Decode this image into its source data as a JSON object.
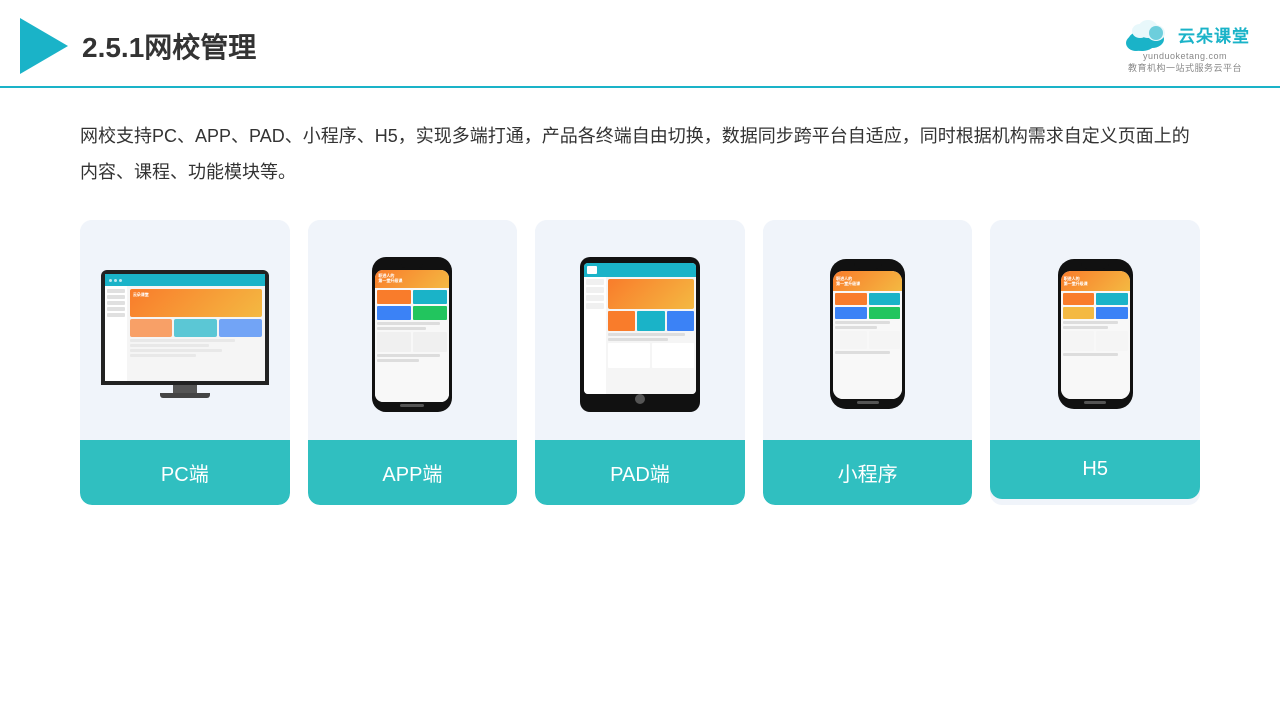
{
  "header": {
    "title": "2.5.1网校管理",
    "brand_name": "云朵课堂",
    "brand_url": "yunduoketang.com",
    "brand_slogan": "教育机构一站式服务云平台"
  },
  "description": "网校支持PC、APP、PAD、小程序、H5，实现多端打通，产品各终端自由切换，数据同步跨平台自适应，同时根据机构需求自定义页面上的内容、课程、功能模块等。",
  "cards": [
    {
      "id": "pc",
      "label": "PC端"
    },
    {
      "id": "app",
      "label": "APP端"
    },
    {
      "id": "pad",
      "label": "PAD端"
    },
    {
      "id": "miniprogram",
      "label": "小程序"
    },
    {
      "id": "h5",
      "label": "H5"
    }
  ],
  "colors": {
    "primary": "#1ab3c8",
    "card_bg": "#edf1f8",
    "card_label_bg": "#30bfc0",
    "text_dark": "#333333"
  }
}
